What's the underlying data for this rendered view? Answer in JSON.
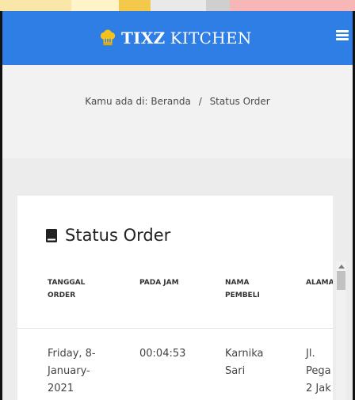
{
  "navbar": {
    "brand_bold": "TIXZ",
    "brand_rest": "KITCHEN",
    "menu_icon": "hamburger-icon",
    "logo_icon": "chef-hat-icon",
    "bg_color": "#2f7ee6"
  },
  "breadcrumb": {
    "prefix": "Kamu ada di:",
    "home": "Beranda",
    "separator": "/",
    "current": "Status Order"
  },
  "card": {
    "title": "Status Order",
    "title_icon": "book-icon"
  },
  "table": {
    "headers": [
      "TANGGAL ORDER",
      "PADA JAM",
      "NAMA PEMBELI",
      "ALAMAT"
    ],
    "header_lines": [
      [
        "TANGGAL",
        "ORDER"
      ],
      [
        "PADA JAM"
      ],
      [
        "NAMA",
        "PEMBELI"
      ],
      [
        "ALAMA"
      ]
    ],
    "rows": [
      {
        "tanggal_lines": [
          "Friday, 8-",
          "January-",
          "2021"
        ],
        "jam": "00:04:53",
        "nama_lines": [
          "Karnika",
          "Sari"
        ],
        "alamat_lines": [
          "Jl.",
          "Pega",
          "2 Jak"
        ]
      }
    ]
  }
}
